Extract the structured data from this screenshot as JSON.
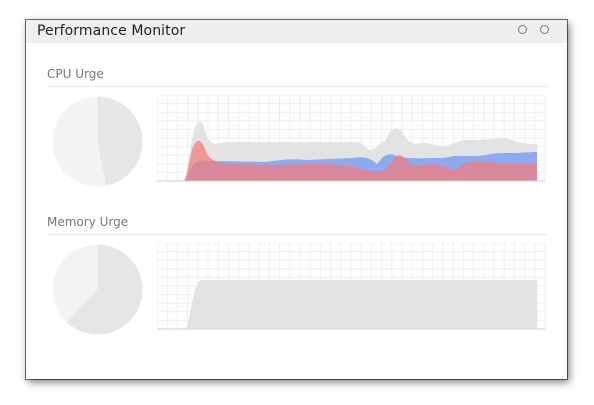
{
  "window": {
    "title": "Performance Monitor"
  },
  "sections": [
    {
      "id": "cpu",
      "title": "CPU Urge",
      "pie": {
        "used_fraction": 0.47,
        "used_color": "#e6e6e6",
        "free_color": "#f3f3f3"
      }
    },
    {
      "id": "memory",
      "title": "Memory Urge",
      "pie": {
        "used_fraction": 0.62,
        "used_color": "#e6e6e6",
        "free_color": "#f3f3f3"
      }
    }
  ],
  "colors": {
    "grid": "#eeeeee",
    "gray_area": "#e2e2e2",
    "blue_area": "#7f9ff0",
    "red_area": "#f07d7d"
  }
}
